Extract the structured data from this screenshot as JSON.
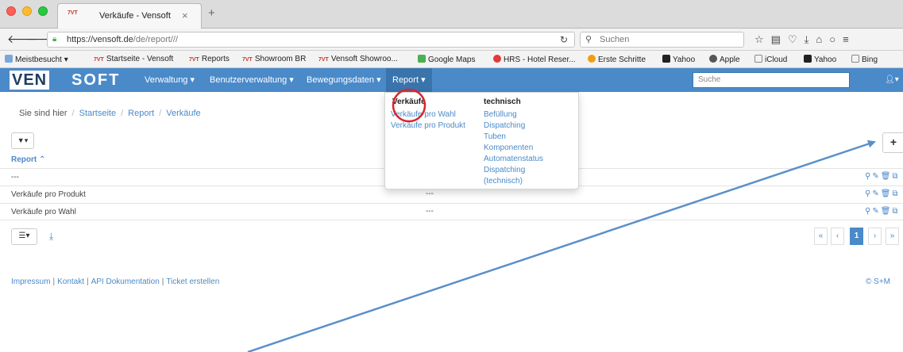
{
  "browser": {
    "tab_title": "Verkäufe - Vensoft",
    "tab_favicon": "7VT",
    "url_main": "https://vensoft.de",
    "url_path": "/de/report///",
    "search_placeholder": "Suchen",
    "bookmarks": [
      "Meistbesucht",
      "Startseite - Vensoft",
      "Reports",
      "Showroom BR",
      "Vensoft Showroo...",
      "Google Maps",
      "HRS - Hotel Reser...",
      "Erste Schritte",
      "Yahoo",
      "Apple",
      "iCloud",
      "Yahoo",
      "Bing"
    ]
  },
  "app": {
    "logo_left": "VEN",
    "logo_right": "SOFT",
    "nav": [
      {
        "label": "Verwaltung"
      },
      {
        "label": "Benutzerverwaltung"
      },
      {
        "label": "Bewegungsdaten"
      },
      {
        "label": "Report"
      }
    ],
    "search_placeholder": "Suche"
  },
  "dropdown": {
    "col1_header": "Verkäufe",
    "col1_items": [
      "Verkäufe pro Wahl",
      "Verkäufe pro Produkt"
    ],
    "col2_header": "technisch",
    "col2_items": [
      "Befüllung",
      "Dispatching",
      "Tuben",
      "Komponenten",
      "Automatenstatus",
      "Dispatching",
      "(technisch)"
    ]
  },
  "page": {
    "breadcrumb_prefix": "Sie sind hier",
    "breadcrumb": [
      "Startseite",
      "Report",
      "Verkäufe"
    ],
    "column_header": "Report",
    "filter_row": "---",
    "rows": [
      {
        "name": "Verkäufe pro Produkt",
        "value": "---"
      },
      {
        "name": "Verkäufe pro Wahl",
        "value": "---"
      }
    ],
    "pagination": {
      "first": "«",
      "prev": "‹",
      "current": "1",
      "next": "›",
      "last": "»"
    },
    "footer_links": [
      "Impressum",
      "Kontakt",
      "API Dokumentation",
      "Ticket erstellen"
    ],
    "copyright": "© S+M"
  },
  "colors": {
    "navbar": "#4a8ac9",
    "link": "#4a8ac9",
    "annotation_arrow": "#5b8fc9",
    "annotation_circle": "#d9262a"
  }
}
